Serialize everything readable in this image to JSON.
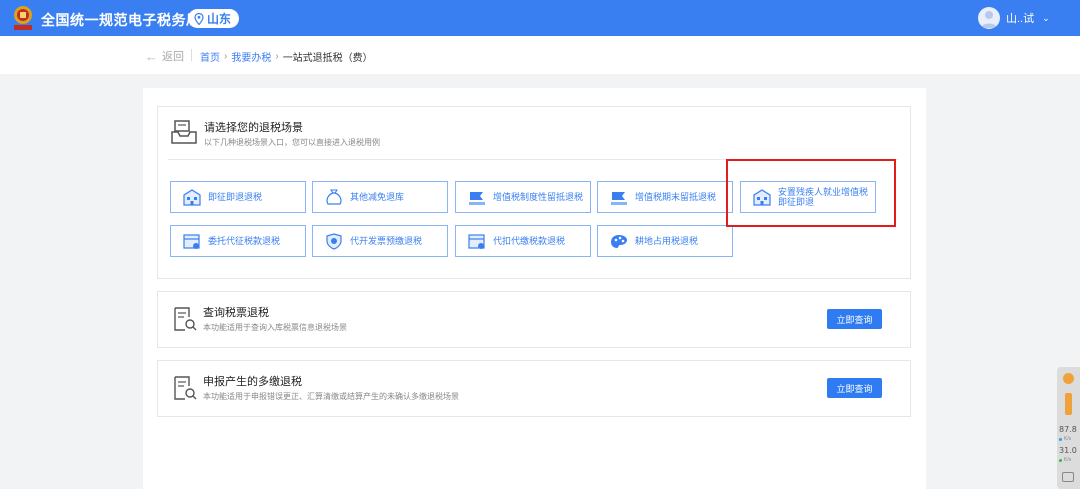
{
  "header": {
    "site_title": "全国统一规范电子税务局",
    "region": "山东",
    "user_name": "山..试",
    "caret": "⌄"
  },
  "breadcrumb": {
    "back_label": "返回",
    "back_arrow": "←",
    "items": [
      "首页",
      "我要办税",
      "一站式退抵税（费）"
    ],
    "separator": "›"
  },
  "scenario_section": {
    "title": "请选择您的退税场景",
    "description": "以下几种退税场景入口，您可以直接进入退税用例",
    "tiles": [
      {
        "label": "即征即退退税",
        "icon": "building-icon"
      },
      {
        "label": "其他减免退库",
        "icon": "money-bag-icon"
      },
      {
        "label": "增值税制度性留抵退税",
        "icon": "flag-icon"
      },
      {
        "label": "增值税期末留抵退税",
        "icon": "flag-icon"
      },
      {
        "label": "安置残疾人就业增值税即征即退",
        "icon": "building-icon"
      },
      {
        "label": "委托代征税款退税",
        "icon": "id-card-icon"
      },
      {
        "label": "代开发票预缴退税",
        "icon": "shield-icon"
      },
      {
        "label": "代扣代缴税款退税",
        "icon": "id-card-icon"
      },
      {
        "label": "耕地占用税退税",
        "icon": "palette-icon"
      }
    ]
  },
  "query_section": {
    "title": "查询税票退税",
    "description": "本功能适用于查询入库税票信息退税场景",
    "button": "立即查询"
  },
  "overpaid_section": {
    "title": "申报产生的多缴退税",
    "description": "本功能适用于申报错误更正、汇算清缴或结算产生的未确认多缴退税场景",
    "button": "立即查询"
  },
  "side_widget": {
    "value1": "87.8",
    "unit1": "K/s",
    "value2": "31.0",
    "unit2": "K/s"
  },
  "colors": {
    "primary": "#3a7ff2",
    "highlight_box": "#e01e1e"
  }
}
